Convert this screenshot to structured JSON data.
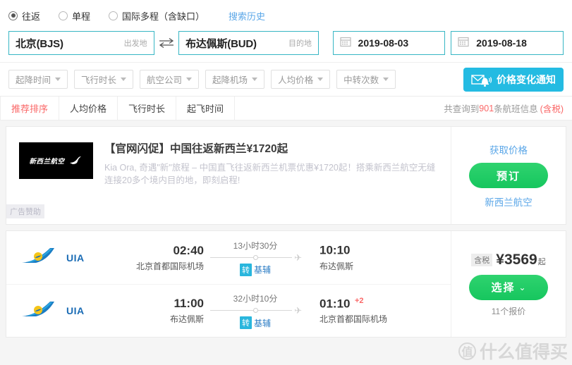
{
  "search": {
    "trip_types": [
      {
        "label": "往返",
        "checked": true
      },
      {
        "label": "单程",
        "checked": false
      },
      {
        "label": "国际多程（含缺口）",
        "checked": false
      }
    ],
    "history_link": "搜索历史",
    "origin": {
      "value": "北京(BJS)",
      "hint": "出发地"
    },
    "destination": {
      "value": "布达佩斯(BUD)",
      "hint": "目的地"
    },
    "depart_date": "2019-08-03",
    "return_date": "2019-08-18"
  },
  "filters": [
    "起降时间",
    "飞行时长",
    "航空公司",
    "起降机场",
    "人均价格",
    "中转次数"
  ],
  "notify_button": "价格变化通知",
  "sort": {
    "tabs": [
      {
        "label": "推荐排序",
        "active": true
      },
      {
        "label": "人均价格",
        "active": false
      },
      {
        "label": "飞行时长",
        "active": false
      },
      {
        "label": "起飞时间",
        "active": false
      }
    ],
    "count_prefix": "共查询到",
    "count_num": "901",
    "count_suffix": "条航班信息",
    "count_tax": "(含税)"
  },
  "ad": {
    "logo_text": "新西兰航空",
    "title": "【官网闪促】中国往返新西兰¥1720起",
    "desc": "Kia Ora, 奇遇\"新\"旅程 – 中国直飞往返新西兰机票优惠¥1720起！搭乘新西兰航空无缝连接20多个境内目的地，即刻启程!",
    "badge": "广告赞助",
    "get_price": "获取价格",
    "book_label": "预订",
    "airline": "新西兰航空"
  },
  "flight": {
    "segments": [
      {
        "airline": "UIA",
        "depart_time": "02:40",
        "depart_airport": "北京首都国际机场",
        "duration": "13小时30分",
        "transfer_badge": "转",
        "transfer_city": "基辅",
        "arrive_time": "10:10",
        "arrive_plus": "",
        "arrive_airport": "布达佩斯"
      },
      {
        "airline": "UIA",
        "depart_time": "11:00",
        "depart_airport": "布达佩斯",
        "duration": "32小时10分",
        "transfer_badge": "转",
        "transfer_city": "基辅",
        "arrive_time": "01:10",
        "arrive_plus": "+2",
        "arrive_airport": "北京首都国际机场"
      }
    ],
    "tax_badge": "含税",
    "price": "¥3569",
    "price_suffix": "起",
    "select_label": "选择",
    "offers": "11个报价"
  },
  "watermark": {
    "mark": "值",
    "text": "什么值得买"
  },
  "colors": {
    "accent_cyan": "#24bbe2",
    "field_border": "#37b6c4",
    "green": "#16c65e",
    "red": "#fa6767",
    "link_blue": "#5ba7e8"
  }
}
